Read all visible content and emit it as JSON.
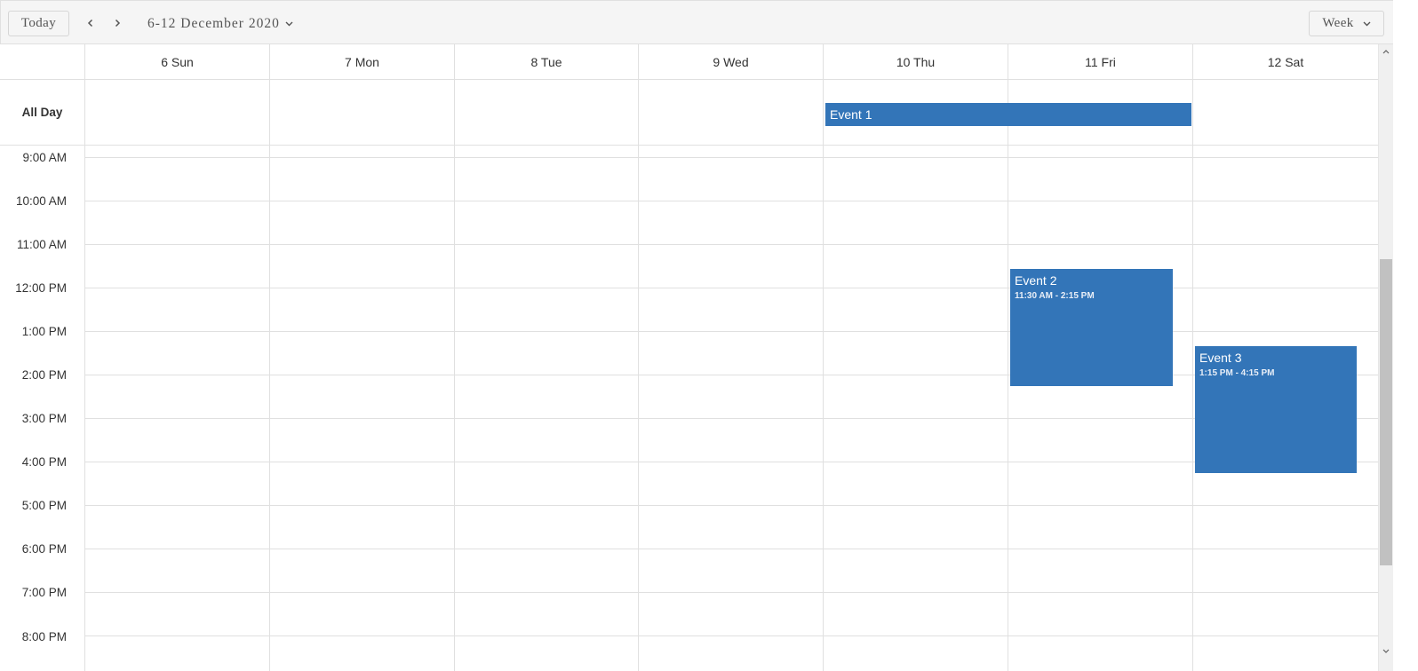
{
  "toolbar": {
    "today_label": "Today",
    "prev_icon": "chevron-left-icon",
    "next_icon": "chevron-right-icon",
    "date_range": "6-12 December 2020",
    "view_label": "Week"
  },
  "calendar": {
    "days": [
      {
        "label": "6 Sun"
      },
      {
        "label": "7 Mon"
      },
      {
        "label": "8 Tue"
      },
      {
        "label": "9 Wed"
      },
      {
        "label": "10 Thu"
      },
      {
        "label": "11 Fri"
      },
      {
        "label": "12 Sat"
      }
    ],
    "all_day_label": "All Day",
    "time_slots": [
      "9:00 AM",
      "10:00 AM",
      "11:00 AM",
      "12:00 PM",
      "1:00 PM",
      "2:00 PM",
      "3:00 PM",
      "4:00 PM",
      "5:00 PM",
      "6:00 PM",
      "7:00 PM",
      "8:00 PM"
    ],
    "events": [
      {
        "title": "Event 1",
        "all_day": true,
        "start_day": "10 Thu",
        "end_day": "11 Fri"
      },
      {
        "title": "Event 2",
        "time": "11:30 AM - 2:15 PM",
        "day": "11 Fri"
      },
      {
        "title": "Event 3",
        "time": "1:15 PM - 4:15 PM",
        "day": "12 Sat"
      }
    ],
    "event_color": "#3375b8"
  }
}
